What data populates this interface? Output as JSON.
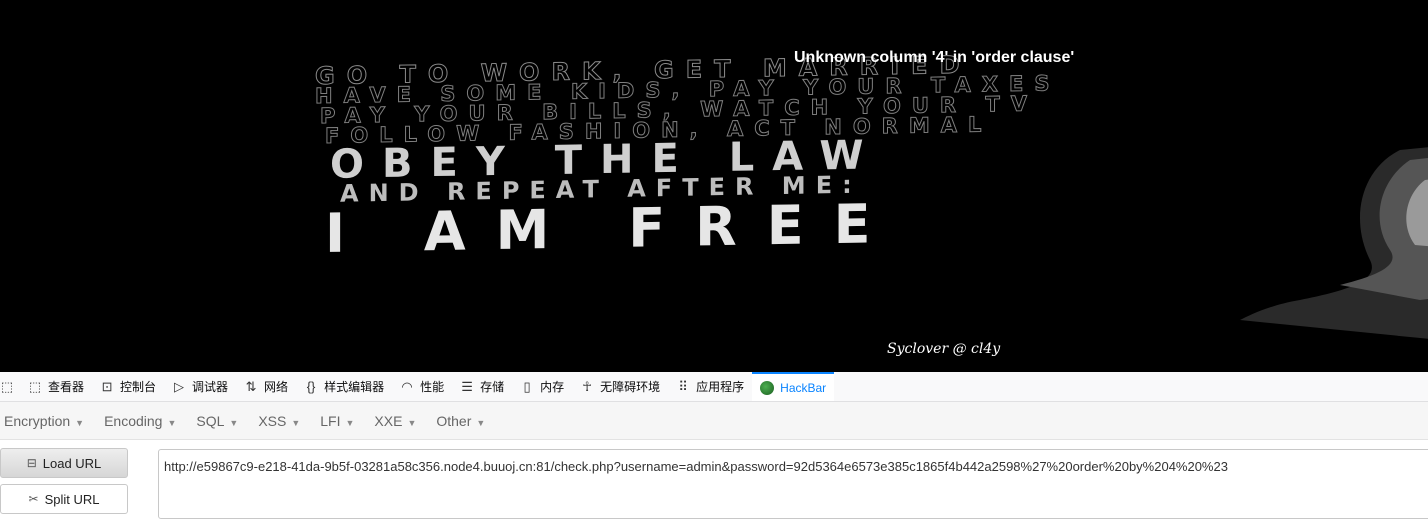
{
  "page": {
    "error_message": "Unknown column '4' in 'order clause'",
    "signature": "Syclover @ cl4y",
    "wall_lines": [
      "GO TO WORK, GET MARRIED",
      "HAVE SOME KIDS, PAY YOUR TAXES",
      "PAY YOUR BILLS, WATCH YOUR TV",
      "FOLLOW FASHION, ACT NORMAL",
      "OBEY THE LAW",
      "AND REPEAT AFTER ME:",
      "I AM FREE"
    ]
  },
  "devtools": {
    "tabs": [
      {
        "label": "查看器",
        "icon": "inspector-icon"
      },
      {
        "label": "控制台",
        "icon": "console-icon"
      },
      {
        "label": "调试器",
        "icon": "debugger-icon"
      },
      {
        "label": "网络",
        "icon": "network-icon"
      },
      {
        "label": "样式编辑器",
        "icon": "style-editor-icon"
      },
      {
        "label": "性能",
        "icon": "performance-icon"
      },
      {
        "label": "存储",
        "icon": "storage-icon"
      },
      {
        "label": "内存",
        "icon": "memory-icon"
      },
      {
        "label": "无障碍环境",
        "icon": "accessibility-icon"
      },
      {
        "label": "应用程序",
        "icon": "application-icon"
      },
      {
        "label": "HackBar",
        "icon": "hackbar-icon"
      }
    ],
    "active_tab": "HackBar"
  },
  "hackbar": {
    "menu": [
      "Encryption",
      "Encoding",
      "SQL",
      "XSS",
      "LFI",
      "XXE",
      "Other"
    ],
    "load_url_label": "Load URL",
    "split_url_label": "Split URL",
    "url_value": "http://e59867c9-e218-41da-9b5f-03281a58c356.node4.buuoj.cn:81/check.php?username=admin&password=92d5364e6573e385c1865f4b442a2598%27%20order%20by%204%20%23"
  },
  "colors": {
    "accent": "#0a84ff",
    "page_background": "#000000",
    "error_text": "#ffffff"
  }
}
